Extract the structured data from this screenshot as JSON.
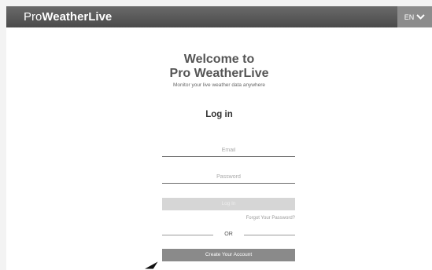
{
  "header": {
    "brand_pro": "Pro",
    "brand_weatherlive": "WeatherLive",
    "language": "EN"
  },
  "welcome": {
    "line1": "Welcome to",
    "line2": "Pro WeatherLive",
    "subtitle": "Monitor your live weather data anywhere"
  },
  "login": {
    "title": "Log in",
    "email_placeholder": "Email",
    "password_placeholder": "Password",
    "login_button": "Log In",
    "forgot_password": "Forgot Your Password?",
    "or_label": "OR",
    "create_account": "Create Your Account"
  },
  "colors": {
    "topbar": "#4a4a4a",
    "lang_bg": "#8c8c8c",
    "create_btn": "#8a8a8a",
    "login_btn_disabled": "#d6d6d6"
  },
  "icons": {
    "language_toggle": "chevron-down-icon",
    "pointer": "mouse-cursor-icon"
  }
}
